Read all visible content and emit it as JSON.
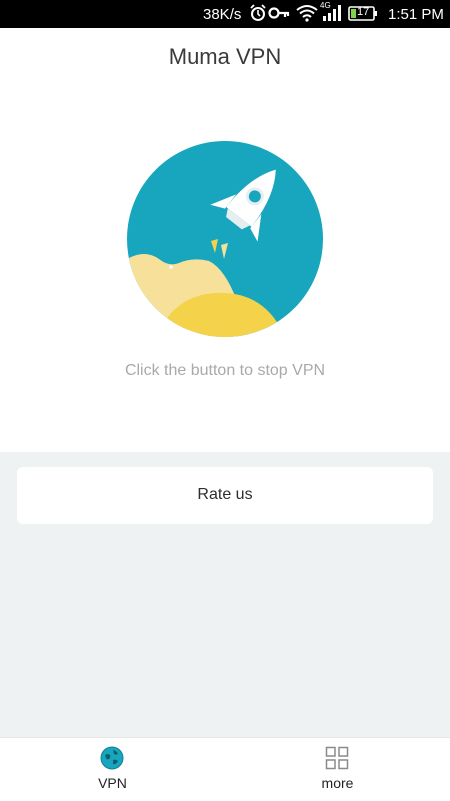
{
  "status_bar": {
    "network_speed": "38K/s",
    "network_type": "4G",
    "battery_level": "17",
    "time": "1:51 PM",
    "icons": [
      "alarm-icon",
      "key-icon",
      "wifi-icon",
      "signal-icon",
      "battery-icon"
    ]
  },
  "header": {
    "title": "Muma VPN"
  },
  "main": {
    "status_text": "Click the button to stop VPN",
    "colors": {
      "circle": "#17a6bd",
      "rocket": "#ffffff",
      "cloud_light": "#f7e19a",
      "cloud_dark": "#f4d24a"
    }
  },
  "card": {
    "rate_label": "Rate us"
  },
  "bottom_nav": {
    "items": [
      {
        "label": "VPN",
        "icon": "globe-icon",
        "active": true
      },
      {
        "label": "more",
        "icon": "grid-icon",
        "active": false
      }
    ]
  }
}
